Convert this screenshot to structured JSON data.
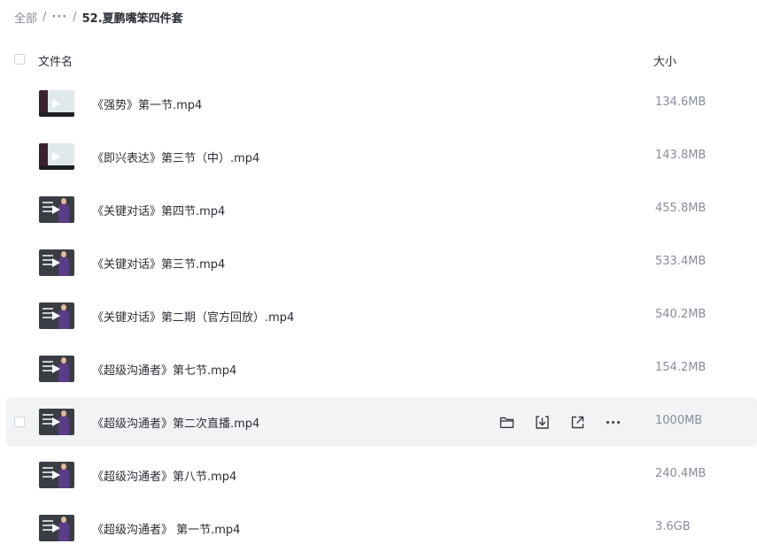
{
  "breadcrumb": {
    "root": "全部",
    "sep": "/",
    "more": "···",
    "current": "52.夏鹏嘴笨四件套"
  },
  "header": {
    "name_label": "文件名",
    "size_label": "大小"
  },
  "files": [
    {
      "name": "《强势》第一节.mp4",
      "size": "134.6MB"
    },
    {
      "name": "《即兴表达》第三节（中）.mp4",
      "size": "143.8MB"
    },
    {
      "name": "《关键对话》第四节.mp4",
      "size": "455.8MB"
    },
    {
      "name": "《关键对话》第三节.mp4",
      "size": "533.4MB"
    },
    {
      "name": "《关键对话》第二期（官方回放）.mp4",
      "size": "540.2MB"
    },
    {
      "name": "《超级沟通者》第七节.mp4",
      "size": "154.2MB"
    },
    {
      "name": "《超级沟通者》第二次直播.mp4",
      "size": "1000MB"
    },
    {
      "name": "《超级沟通者》第八节.mp4",
      "size": "240.4MB"
    },
    {
      "name": "《超级沟通者》 第一节.mp4",
      "size": "3.6GB"
    }
  ],
  "row_actions": {
    "open_folder": "folder-icon",
    "download": "download-icon",
    "share": "share-icon",
    "more": "more-icon"
  },
  "colors": {
    "hover_row_bg": "#f2f3f5",
    "muted_text": "#878c9c",
    "primary_text": "#2b2f36"
  }
}
